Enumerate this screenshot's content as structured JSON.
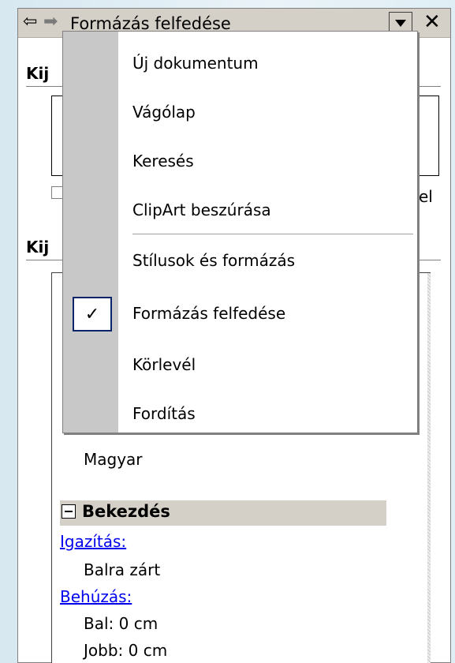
{
  "task_pane": {
    "title": "Formázás felfedése",
    "nav_back_glyph": "⇦",
    "nav_forward_glyph": "➡",
    "close_glyph": "✕",
    "fragments": {
      "section1": "Kij",
      "section2": "Kij",
      "checkbox_tail": "el"
    },
    "reveal": {
      "language_value": "Magyar",
      "section_label": "Bekezdés",
      "alignment_link": "Igazítás:",
      "alignment_value": "Balra zárt",
      "indent_link": "Behúzás:",
      "indent_left": "Bal:  0 cm",
      "indent_right": "Jobb:  0 cm"
    }
  },
  "dropdown_menu": {
    "items": [
      {
        "label": "Új dokumentum",
        "checked": false
      },
      {
        "label": "Vágólap",
        "checked": false
      },
      {
        "label": "Keresés",
        "checked": false
      },
      {
        "label": "ClipArt beszúrása",
        "checked": false
      },
      {
        "label": "Stílusok és formázás",
        "checked": false
      },
      {
        "label": "Formázás felfedése",
        "checked": true
      },
      {
        "label": "Körlevél",
        "checked": false
      },
      {
        "label": "Fordítás",
        "checked": false
      }
    ],
    "check_glyph": "✓"
  },
  "colors": {
    "link": "#0000ee",
    "menu_strip": "#c8c8c8",
    "selected_border": "#0a246a",
    "titlebar": "#d4d0c8"
  }
}
